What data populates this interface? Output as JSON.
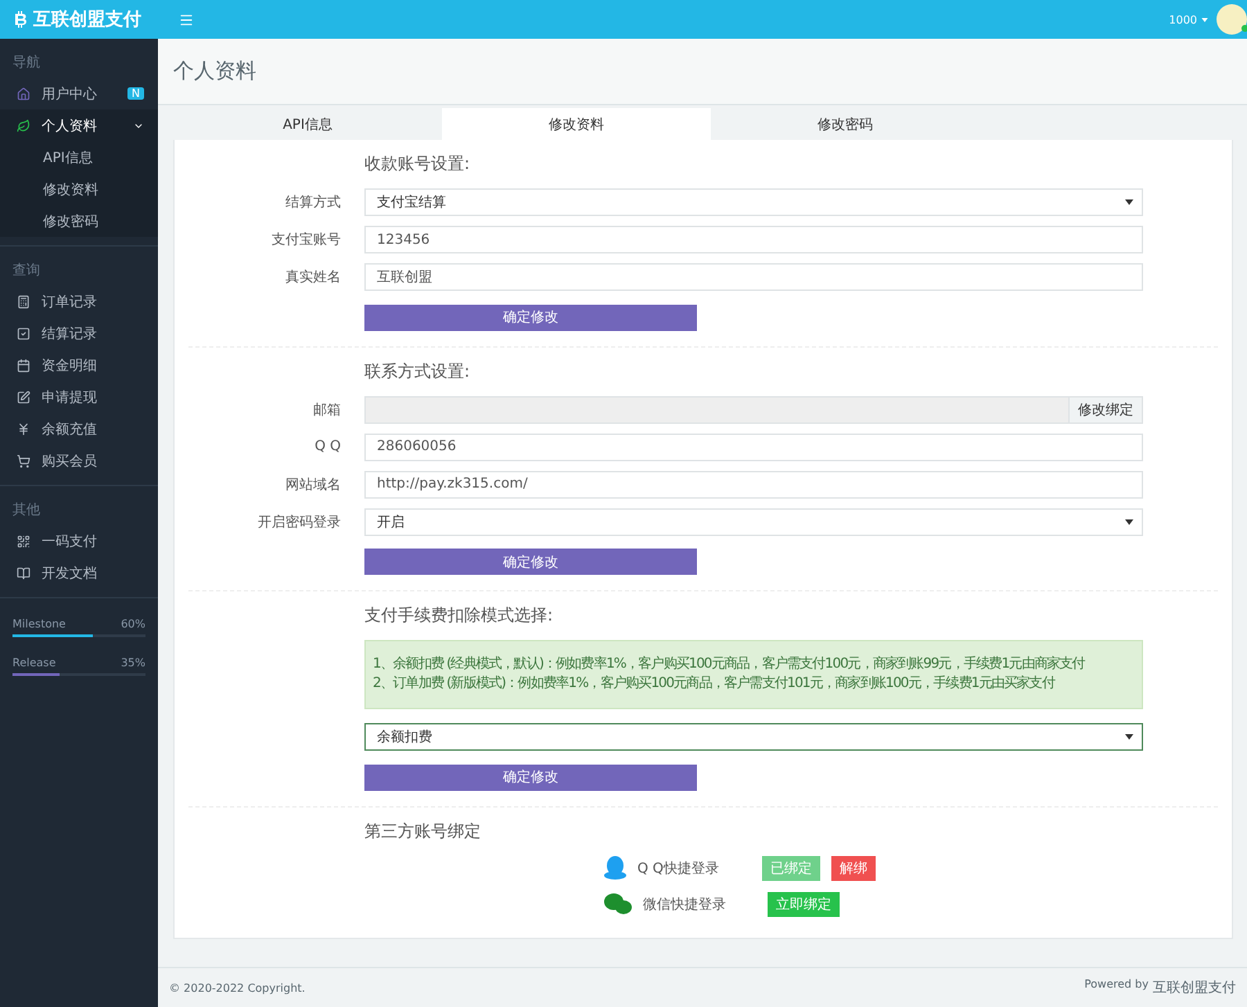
{
  "brand": {
    "name": "互联创盟支付"
  },
  "topbar": {
    "user": "1000"
  },
  "sidebar": {
    "sections": [
      {
        "title": "导航",
        "items": [
          {
            "label": "用户中心",
            "badge": "N",
            "selected": false
          },
          {
            "label": "个人资料",
            "selected": true,
            "expanded": true,
            "children": [
              {
                "label": "API信息",
                "selected": false
              },
              {
                "label": "修改资料",
                "selected": false
              },
              {
                "label": "修改密码",
                "selected": false
              }
            ]
          }
        ]
      },
      {
        "title": "查询",
        "items": [
          {
            "label": "订单记录",
            "selected": false
          },
          {
            "label": "结算记录",
            "selected": false
          },
          {
            "label": "资金明细",
            "selected": false
          },
          {
            "label": "申请提现",
            "selected": false
          },
          {
            "label": "余额充值",
            "selected": false
          },
          {
            "label": "购买会员",
            "selected": false
          }
        ]
      },
      {
        "title": "其他",
        "items": [
          {
            "label": "一码支付",
            "selected": false
          },
          {
            "label": "开发文档",
            "selected": false
          }
        ]
      }
    ],
    "progress": [
      {
        "name": "Milestone",
        "reading": "60%",
        "level": 0.6,
        "color": "#23b7e5"
      },
      {
        "name": "Release",
        "reading": "35%",
        "level": 0.35,
        "color": "#7266ba"
      }
    ]
  },
  "page": {
    "title": "个人资料"
  },
  "tabs": [
    {
      "label": "API信息",
      "selected": false
    },
    {
      "label": "修改资料",
      "selected": true
    },
    {
      "label": "修改密码",
      "selected": false
    }
  ],
  "sections": [
    {
      "heading": "收款账号设置:",
      "fields": [
        {
          "label": "结算方式",
          "kind": "select",
          "value": "支付宝结算"
        },
        {
          "label": "支付宝账号",
          "kind": "input",
          "value": "123456"
        },
        {
          "label": "真实姓名",
          "kind": "input",
          "value": "互联创盟"
        }
      ],
      "button": "确定修改"
    },
    {
      "heading": "联系方式设置:",
      "fields": [
        {
          "label": "邮箱",
          "kind": "addon",
          "addon": "修改绑定"
        },
        {
          "label": "Q Q",
          "kind": "input",
          "value": "286060056"
        },
        {
          "label": "网站域名",
          "kind": "input",
          "value": "http://pay.zk315.com/"
        },
        {
          "label": "开启密码登录",
          "kind": "select",
          "value": "开启"
        }
      ],
      "button": "确定修改"
    },
    {
      "heading": "支付手续费扣除模式选择:",
      "notice": [
        "1、余额扣费 (经典模式，默认)：例如费率1%，客户购买100元商品，客户需支付100元，商家到账99元，手续费1元由商家支付",
        "2、订单加费 (新版模式)：例如费率1%，客户购买100元商品，客户需支付101元，商家到账100元，手续费1元由买家支付"
      ],
      "fields": [
        {
          "kind": "select",
          "value": "余额扣费",
          "focused": true
        }
      ],
      "button": "确定修改"
    }
  ],
  "bindings": {
    "heading": "第三方账号绑定",
    "items": [
      {
        "label": "Q Q快捷登录",
        "buttons": [
          {
            "label": "已绑定",
            "kind": "bound"
          },
          {
            "label": "解绑",
            "kind": "unbind"
          }
        ]
      },
      {
        "label": "微信快捷登录",
        "buttons": [
          {
            "label": "立即绑定",
            "kind": "bind"
          }
        ]
      }
    ]
  },
  "footer": {
    "copyright": "© 2020-2022 Copyright.",
    "powered": "Powered by",
    "brand": "互联创盟支付"
  }
}
